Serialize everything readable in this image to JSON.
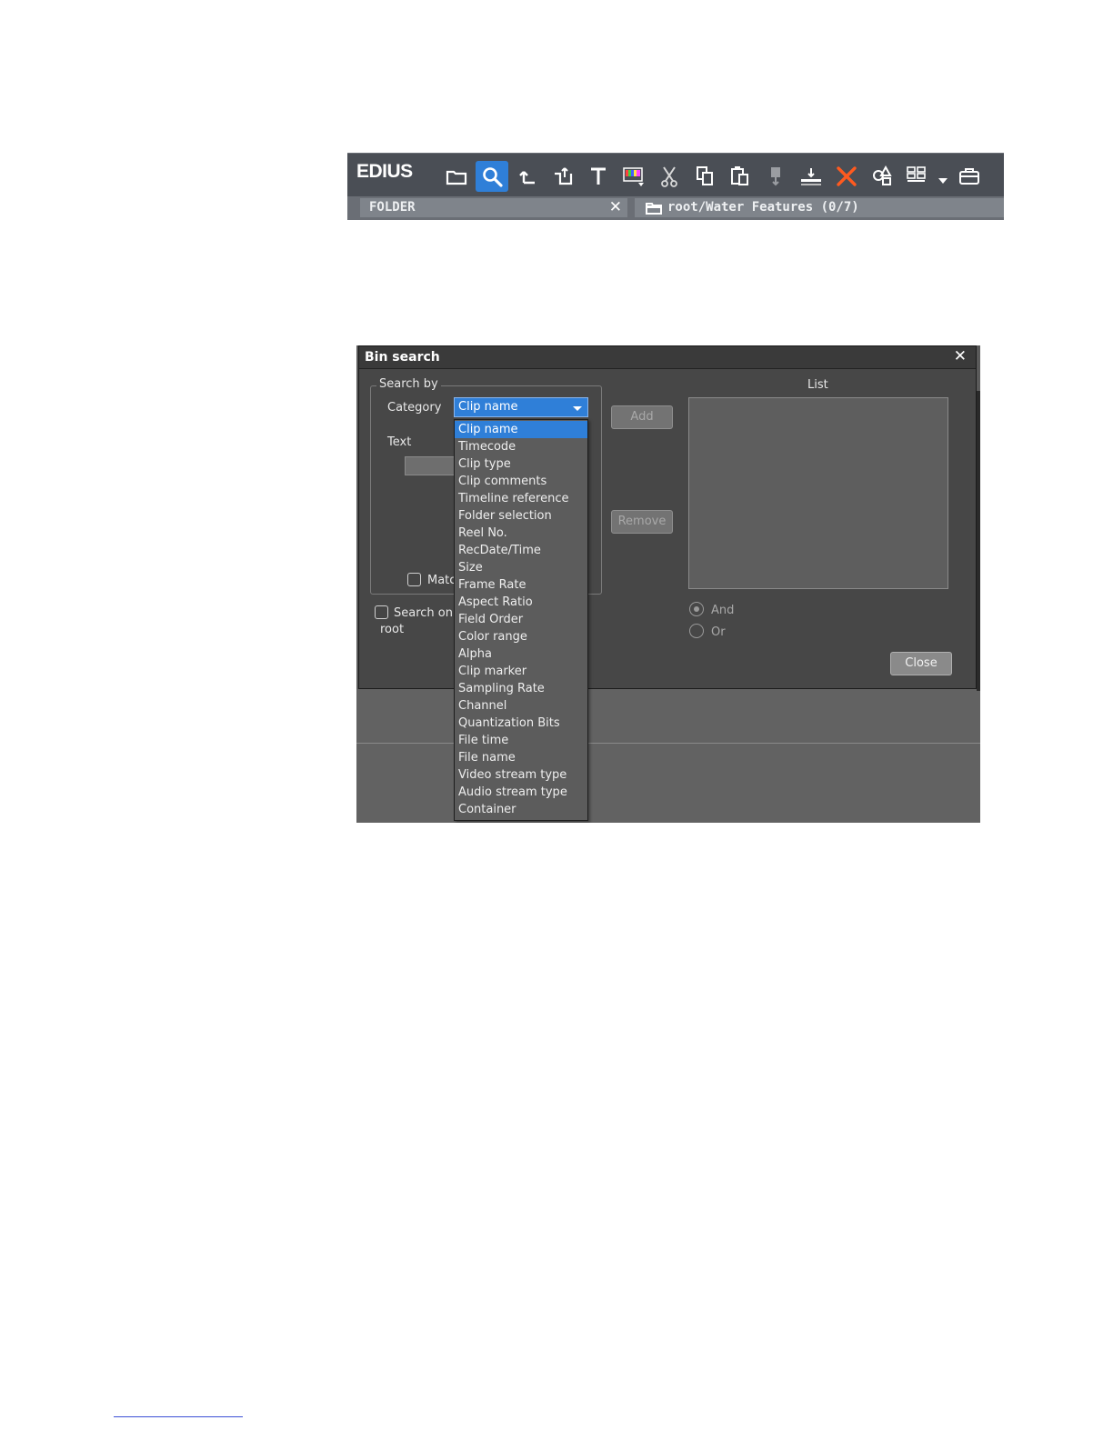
{
  "toolbar": {
    "brand": "EDIUS",
    "tools": [
      {
        "icon": "folder-icon",
        "active": false
      },
      {
        "icon": "search-icon",
        "active": true
      },
      {
        "icon": "up-arrow-icon",
        "active": false
      },
      {
        "icon": "add-folder-icon",
        "active": false
      },
      {
        "icon": "text-icon",
        "active": false
      },
      {
        "icon": "color-bars-icon",
        "active": false
      },
      {
        "icon": "cut-icon",
        "active": false
      },
      {
        "icon": "copy-icon",
        "active": false
      },
      {
        "icon": "paste-icon",
        "active": false
      },
      {
        "icon": "marker-icon",
        "active": false
      },
      {
        "icon": "add-to-timeline-icon",
        "active": false
      },
      {
        "icon": "delete-icon",
        "active": false
      },
      {
        "icon": "properties-icon",
        "active": false
      },
      {
        "icon": "view-toggle-icon",
        "active": false
      },
      {
        "icon": "toolbox-icon",
        "active": false
      }
    ],
    "folder_tab": "FOLDER",
    "folder_close": "✕",
    "path": "root/Water Features (0/7)"
  },
  "dialog": {
    "title": "Bin search",
    "close": "✕",
    "search_by_label": "Search by",
    "category_label": "Category",
    "category_value": "Clip name",
    "text_label": "Text",
    "match_label": "Matc",
    "search_only_label": "Search on",
    "root_label": "root",
    "add_button": "Add",
    "remove_button": "Remove",
    "list_label": "List",
    "and_label": "And",
    "or_label": "Or",
    "close_button": "Close",
    "accent": "#2f7fd8",
    "category_options": [
      "Clip name",
      "Timecode",
      "Clip type",
      "Clip comments",
      "Timeline reference",
      "Folder selection",
      "Reel No.",
      "RecDate/Time",
      "Size",
      "Frame Rate",
      "Aspect Ratio",
      "Field Order",
      "Color range",
      "Alpha",
      "Clip marker",
      "Sampling Rate",
      "Channel",
      "Quantization Bits",
      "File time",
      "File name",
      "Video stream type",
      "Audio stream type",
      "Container"
    ]
  }
}
